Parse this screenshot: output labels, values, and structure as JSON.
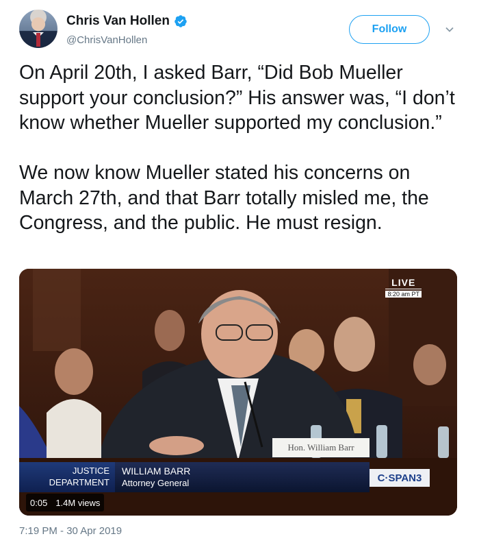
{
  "header": {
    "display_name": "Chris Van Hollen",
    "handle": "@ChrisVanHollen",
    "follow_label": "Follow",
    "verified_icon": "verified-badge-icon",
    "caret_icon": "chevron-down-icon"
  },
  "tweet": {
    "text": "On April 20th, I asked Barr, “Did Bob Mueller support your conclusion?” His answer was, “I don’t know whether Mueller supported my conclusion.”\n\nWe now know Mueller stated his concerns on March 27th, and that Barr totally misled me, the Congress, and the public. He must resign.",
    "timestamp": "7:19 PM - 30 Apr 2019"
  },
  "media": {
    "live_label": "LIVE",
    "live_time": "8:20 am PT",
    "nameplate": "Hon. William Barr",
    "chyron_dept_line1": "JUSTICE",
    "chyron_dept_line2": "DEPARTMENT",
    "chyron_name": "WILLIAM BARR",
    "chyron_title": "Attorney General",
    "network": "C·SPAN3",
    "duration": "0:05",
    "views": "1.4M views"
  },
  "colors": {
    "accent": "#1da1f2",
    "text": "#14171a",
    "muted": "#657786"
  }
}
